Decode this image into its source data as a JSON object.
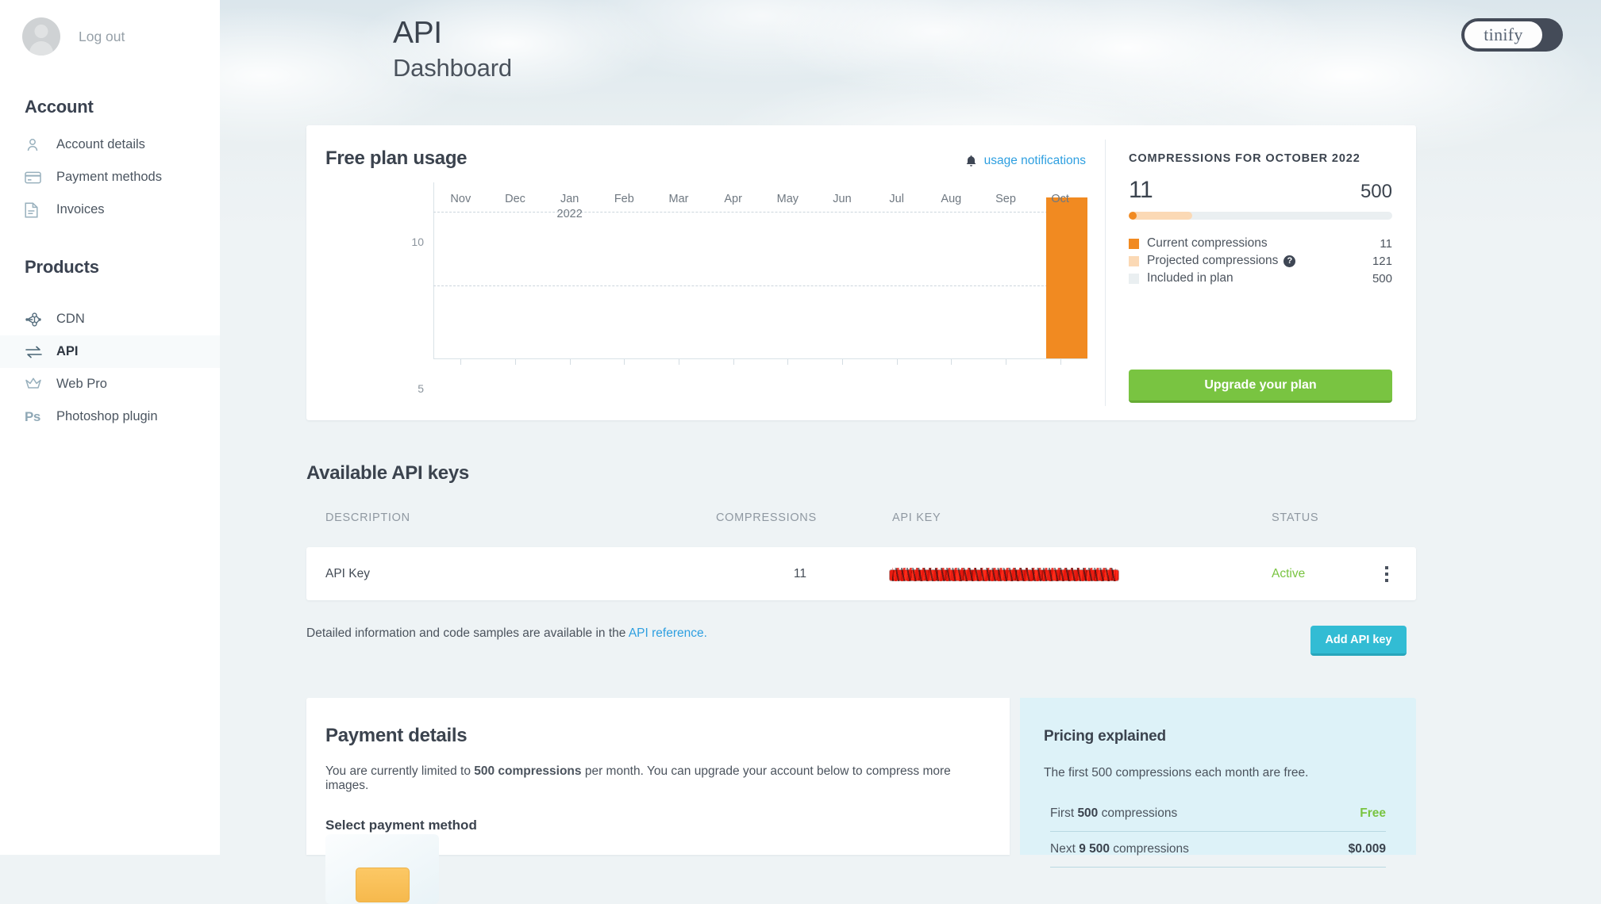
{
  "header": {
    "title": "API",
    "subtitle": "Dashboard",
    "logo_text": "tinify"
  },
  "sidebar": {
    "logout_label": "Log out",
    "avatar_name": "avatar",
    "sections": [
      {
        "heading": "Account",
        "items": [
          {
            "label": "Account details",
            "icon": "user-icon",
            "active": false
          },
          {
            "label": "Payment methods",
            "icon": "credit-card-icon",
            "active": false
          },
          {
            "label": "Invoices",
            "icon": "document-icon",
            "active": false
          }
        ]
      },
      {
        "heading": "Products",
        "items": [
          {
            "label": "CDN",
            "icon": "network-icon",
            "active": false
          },
          {
            "label": "API",
            "icon": "exchange-arrows-icon",
            "active": true
          },
          {
            "label": "Web Pro",
            "icon": "crown-icon",
            "active": false
          },
          {
            "label": "Photoshop plugin",
            "icon": "photoshop-icon",
            "active": false
          }
        ]
      }
    ]
  },
  "usage": {
    "card_title": "Free plan usage",
    "notifications_link": "usage notifications",
    "summary_heading": "COMPRESSIONS FOR OCTOBER 2022",
    "current_value": "11",
    "plan_limit": "500",
    "legend": [
      {
        "label": "Current compressions",
        "value": "11",
        "color": "#f18a21",
        "has_help": false
      },
      {
        "label": "Projected compressions",
        "value": "121",
        "color": "#fbd9b5",
        "has_help": true,
        "help_glyph": "?"
      },
      {
        "label": "Included in plan",
        "value": "500",
        "color": "#eaeff1",
        "has_help": false
      }
    ],
    "upgrade_button": "Upgrade your plan"
  },
  "chart_data": {
    "type": "bar",
    "title": "Free plan usage",
    "categories": [
      "Nov",
      "Dec",
      "Jan",
      "Feb",
      "Mar",
      "Apr",
      "May",
      "Jun",
      "Jul",
      "Aug",
      "Sep",
      "Oct"
    ],
    "category_sublabels": [
      "",
      "",
      "2022",
      "",
      "",
      "",
      "",
      "",
      "",
      "",
      "",
      ""
    ],
    "values": [
      0,
      0,
      0,
      0,
      0,
      0,
      0,
      0,
      0,
      0,
      0,
      11
    ],
    "bar_color": "#f18a21",
    "xlabel": "",
    "ylabel": "",
    "ylim": [
      0,
      12
    ],
    "yticks": [
      5,
      10
    ],
    "ytick_labels": [
      "5",
      "10"
    ],
    "grid": true,
    "legend_position": "none"
  },
  "api_keys": {
    "section_title": "Available API keys",
    "columns": [
      "DESCRIPTION",
      "COMPRESSIONS",
      "API KEY",
      "STATUS"
    ],
    "rows": [
      {
        "description": "API Key",
        "compressions": "11",
        "api_key": "xxxxxxxxxxxxxxxxxxxxxxxxxxxxxxxx",
        "api_key_redacted": true,
        "status": "Active",
        "status_color": "#79c441"
      }
    ],
    "note_prefix": "Detailed information and code samples are available in the ",
    "note_link": "API reference.",
    "add_button": "Add API key"
  },
  "payment": {
    "title": "Payment details",
    "description_prefix": "You are currently limited to ",
    "description_bold": "500 compressions",
    "description_suffix": " per month. You can upgrade your account below to compress more images.",
    "select_label": "Select payment method",
    "method_icon": "credit-card-icon"
  },
  "pricing": {
    "title": "Pricing explained",
    "description": "The first 500 compressions each month are free.",
    "rows": [
      {
        "prefix": "First ",
        "bold": "500",
        "suffix": " compressions",
        "value": "Free",
        "value_kind": "free"
      },
      {
        "prefix": "Next ",
        "bold": "9 500",
        "suffix": " compressions",
        "value": "$0.009",
        "value_kind": "amount"
      }
    ]
  },
  "colors": {
    "accent_orange": "#f18a21",
    "accent_green": "#79c441",
    "accent_cyan": "#32bcd4",
    "link_blue": "#2e9fe0",
    "page_bg": "#eef3f5",
    "pricing_bg": "#ddf2f8"
  }
}
